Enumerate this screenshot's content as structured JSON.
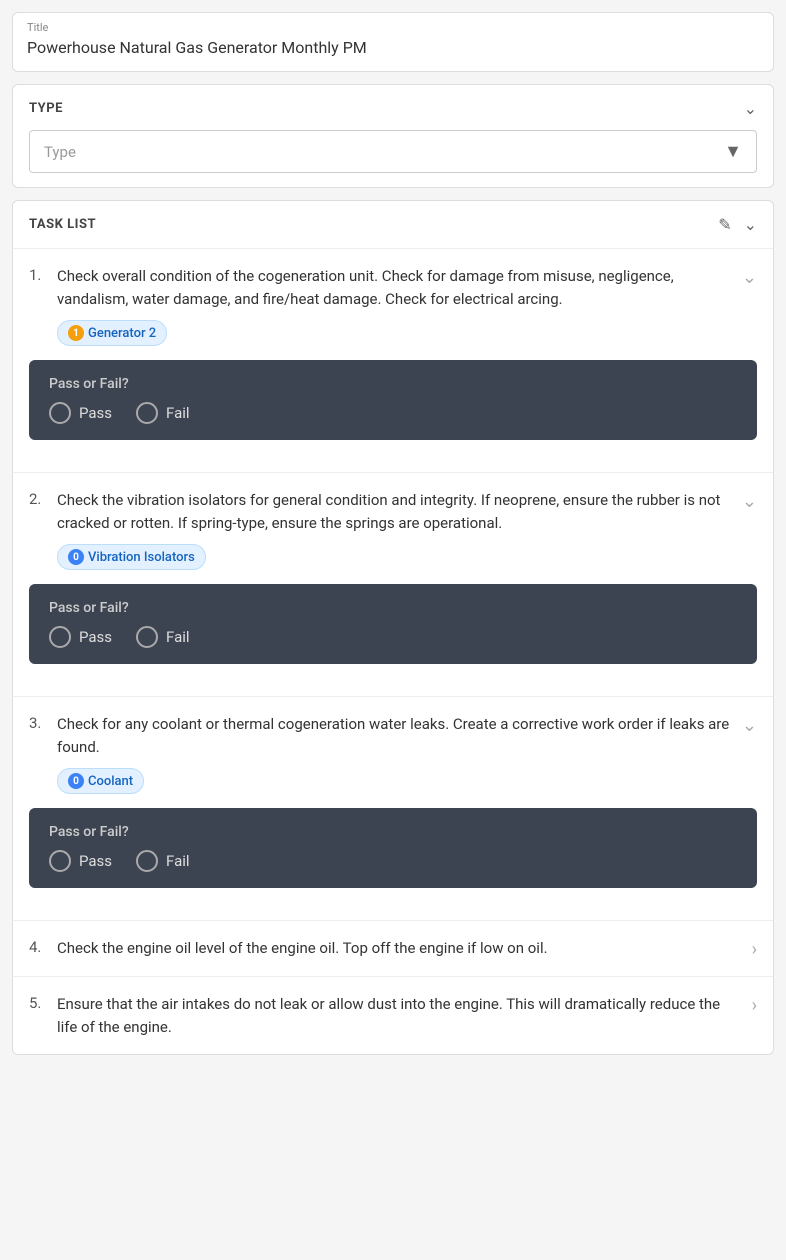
{
  "title": {
    "label": "Title",
    "value": "Powerhouse Natural Gas Generator Monthly PM"
  },
  "type_section": {
    "heading": "TYPE",
    "dropdown_placeholder": "Type"
  },
  "tasklist": {
    "heading": "TASK LIST",
    "tasks": [
      {
        "number": "1.",
        "text": "Check overall condition of the cogeneration unit. Check for damage from misuse, negligence, vandalism, water damage, and fire/heat damage. Check for electrical arcing.",
        "tag_icon": "1",
        "tag_icon_color": "yellow",
        "tag_label": "Generator 2",
        "expanded": true,
        "pass_fail_label": "Pass or Fail?",
        "pass_label": "Pass",
        "fail_label": "Fail"
      },
      {
        "number": "2.",
        "text": "Check the vibration isolators for general condition and integrity. If neoprene, ensure the rubber is not cracked or rotten. If spring-type, ensure the springs are operational.",
        "tag_icon": "0",
        "tag_icon_color": "blue",
        "tag_label": "Vibration Isolators",
        "expanded": true,
        "pass_fail_label": "Pass or Fail?",
        "pass_label": "Pass",
        "fail_label": "Fail"
      },
      {
        "number": "3.",
        "text": "Check for any coolant or thermal cogeneration water leaks. Create a corrective work order if leaks are found.",
        "tag_icon": "0",
        "tag_icon_color": "blue",
        "tag_label": "Coolant",
        "expanded": true,
        "pass_fail_label": "Pass or Fail?",
        "pass_label": "Pass",
        "fail_label": "Fail"
      },
      {
        "number": "4.",
        "text": "Check the engine oil level of the engine oil. Top off the engine if low on oil.",
        "expanded": false
      },
      {
        "number": "5.",
        "text": "Ensure that the air intakes do not leak or allow dust into the engine. This will dramatically reduce the life of the engine.",
        "expanded": false
      }
    ]
  }
}
